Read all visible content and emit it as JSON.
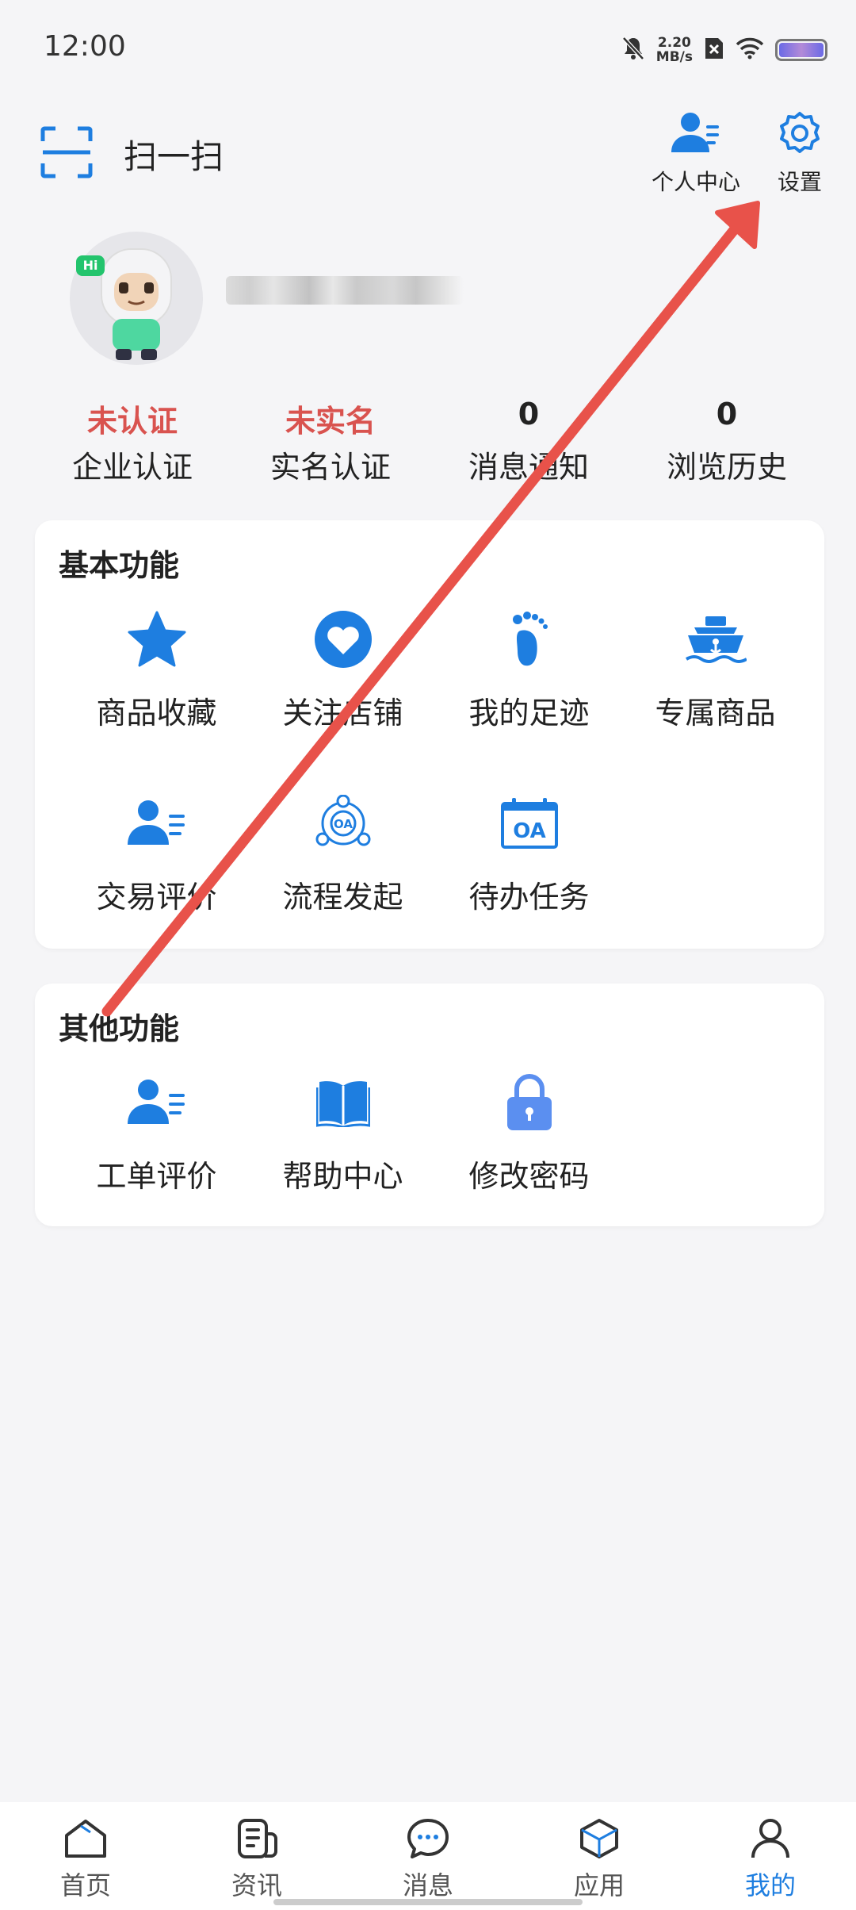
{
  "status_bar": {
    "time": "12:00",
    "net_speed_value": "2.20",
    "net_speed_unit": "MB/s"
  },
  "header": {
    "scan_label": "扫一扫",
    "personal_center_label": "个人中心",
    "settings_label": "设置"
  },
  "profile": {
    "badge": "Hi"
  },
  "stats": [
    {
      "value": "未认证",
      "label": "企业认证"
    },
    {
      "value": "未实名",
      "label": "实名认证"
    },
    {
      "value": "0",
      "label": "消息通知"
    },
    {
      "value": "0",
      "label": "浏览历史"
    }
  ],
  "basic": {
    "title": "基本功能",
    "items": [
      {
        "label": "商品收藏",
        "icon": "star-icon"
      },
      {
        "label": "关注店铺",
        "icon": "heart-icon"
      },
      {
        "label": "我的足迹",
        "icon": "footprint-icon"
      },
      {
        "label": "专属商品",
        "icon": "ship-icon"
      },
      {
        "label": "交易评价",
        "icon": "user-list-icon"
      },
      {
        "label": "流程发起",
        "icon": "oa-workflow-icon"
      },
      {
        "label": "待办任务",
        "icon": "oa-calendar-icon"
      }
    ]
  },
  "other": {
    "title": "其他功能",
    "items": [
      {
        "label": "工单评价",
        "icon": "user-list-icon"
      },
      {
        "label": "帮助中心",
        "icon": "book-icon"
      },
      {
        "label": "修改密码",
        "icon": "lock-icon"
      }
    ]
  },
  "nav": [
    {
      "label": "首页",
      "icon": "home-icon"
    },
    {
      "label": "资讯",
      "icon": "news-icon"
    },
    {
      "label": "消息",
      "icon": "message-icon"
    },
    {
      "label": "应用",
      "icon": "cube-icon"
    },
    {
      "label": "我的",
      "icon": "person-icon",
      "active": true
    }
  ],
  "colors": {
    "accent": "#1e7ee0",
    "warning_red": "#d9534f",
    "annotation_arrow": "#e8524a"
  }
}
